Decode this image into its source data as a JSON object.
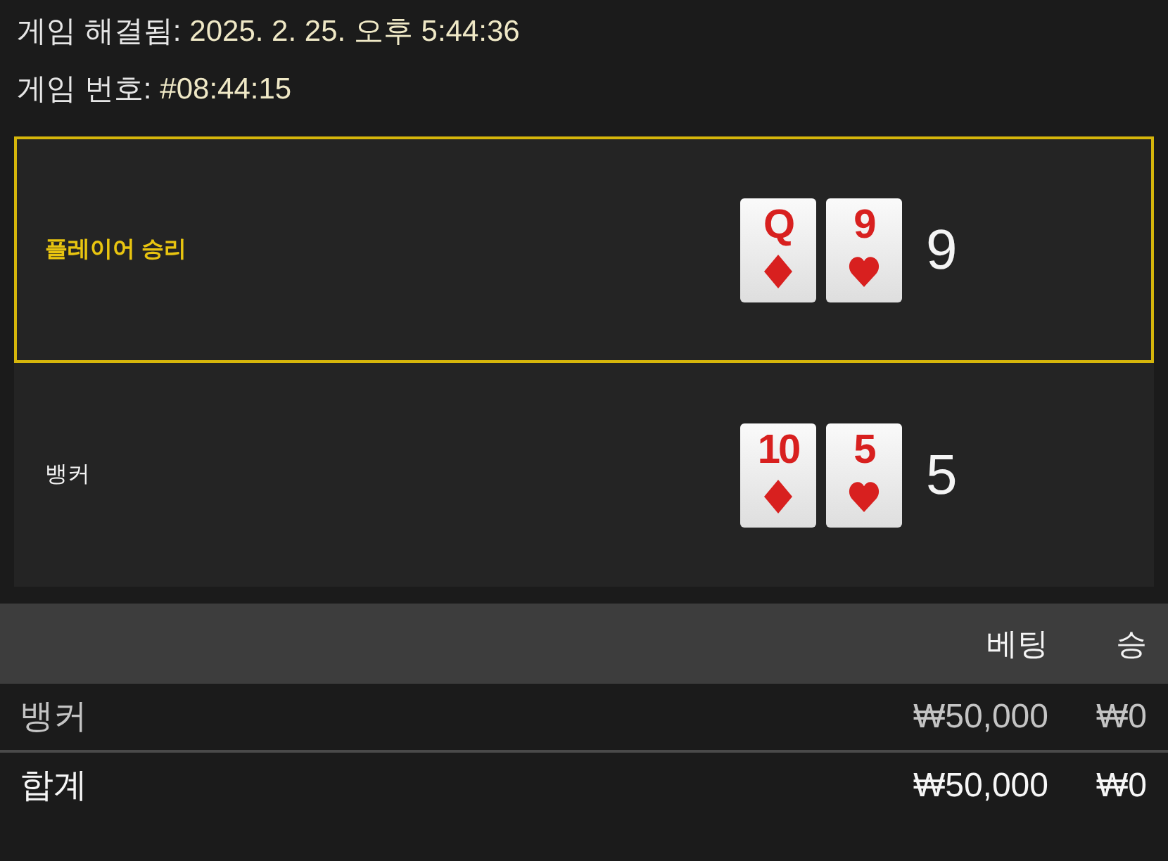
{
  "game_info": [
    {
      "label": "게임 해결됨:",
      "value": "2025. 2. 25. 오후 5:44:36"
    },
    {
      "label": "게임 번호:",
      "value": "#08:44:15"
    }
  ],
  "hands": [
    {
      "label": "플레이어 승리",
      "winner": true,
      "cards": [
        {
          "rank": "Q",
          "kind": "diamond"
        },
        {
          "rank": "9",
          "kind": "heart"
        }
      ],
      "score": "9"
    },
    {
      "label": "뱅커",
      "winner": false,
      "cards": [
        {
          "rank": "10",
          "kind": "diamond"
        },
        {
          "rank": "5",
          "kind": "heart"
        }
      ],
      "score": "5"
    }
  ],
  "bets_table": {
    "columns": [
      "",
      "베팅",
      "승"
    ],
    "rows": [
      {
        "kind": "bet",
        "cells": [
          "뱅커",
          "₩50,000",
          "₩0"
        ]
      },
      {
        "kind": "total",
        "cells": [
          "합계",
          "₩50,000",
          "₩0"
        ]
      }
    ]
  }
}
